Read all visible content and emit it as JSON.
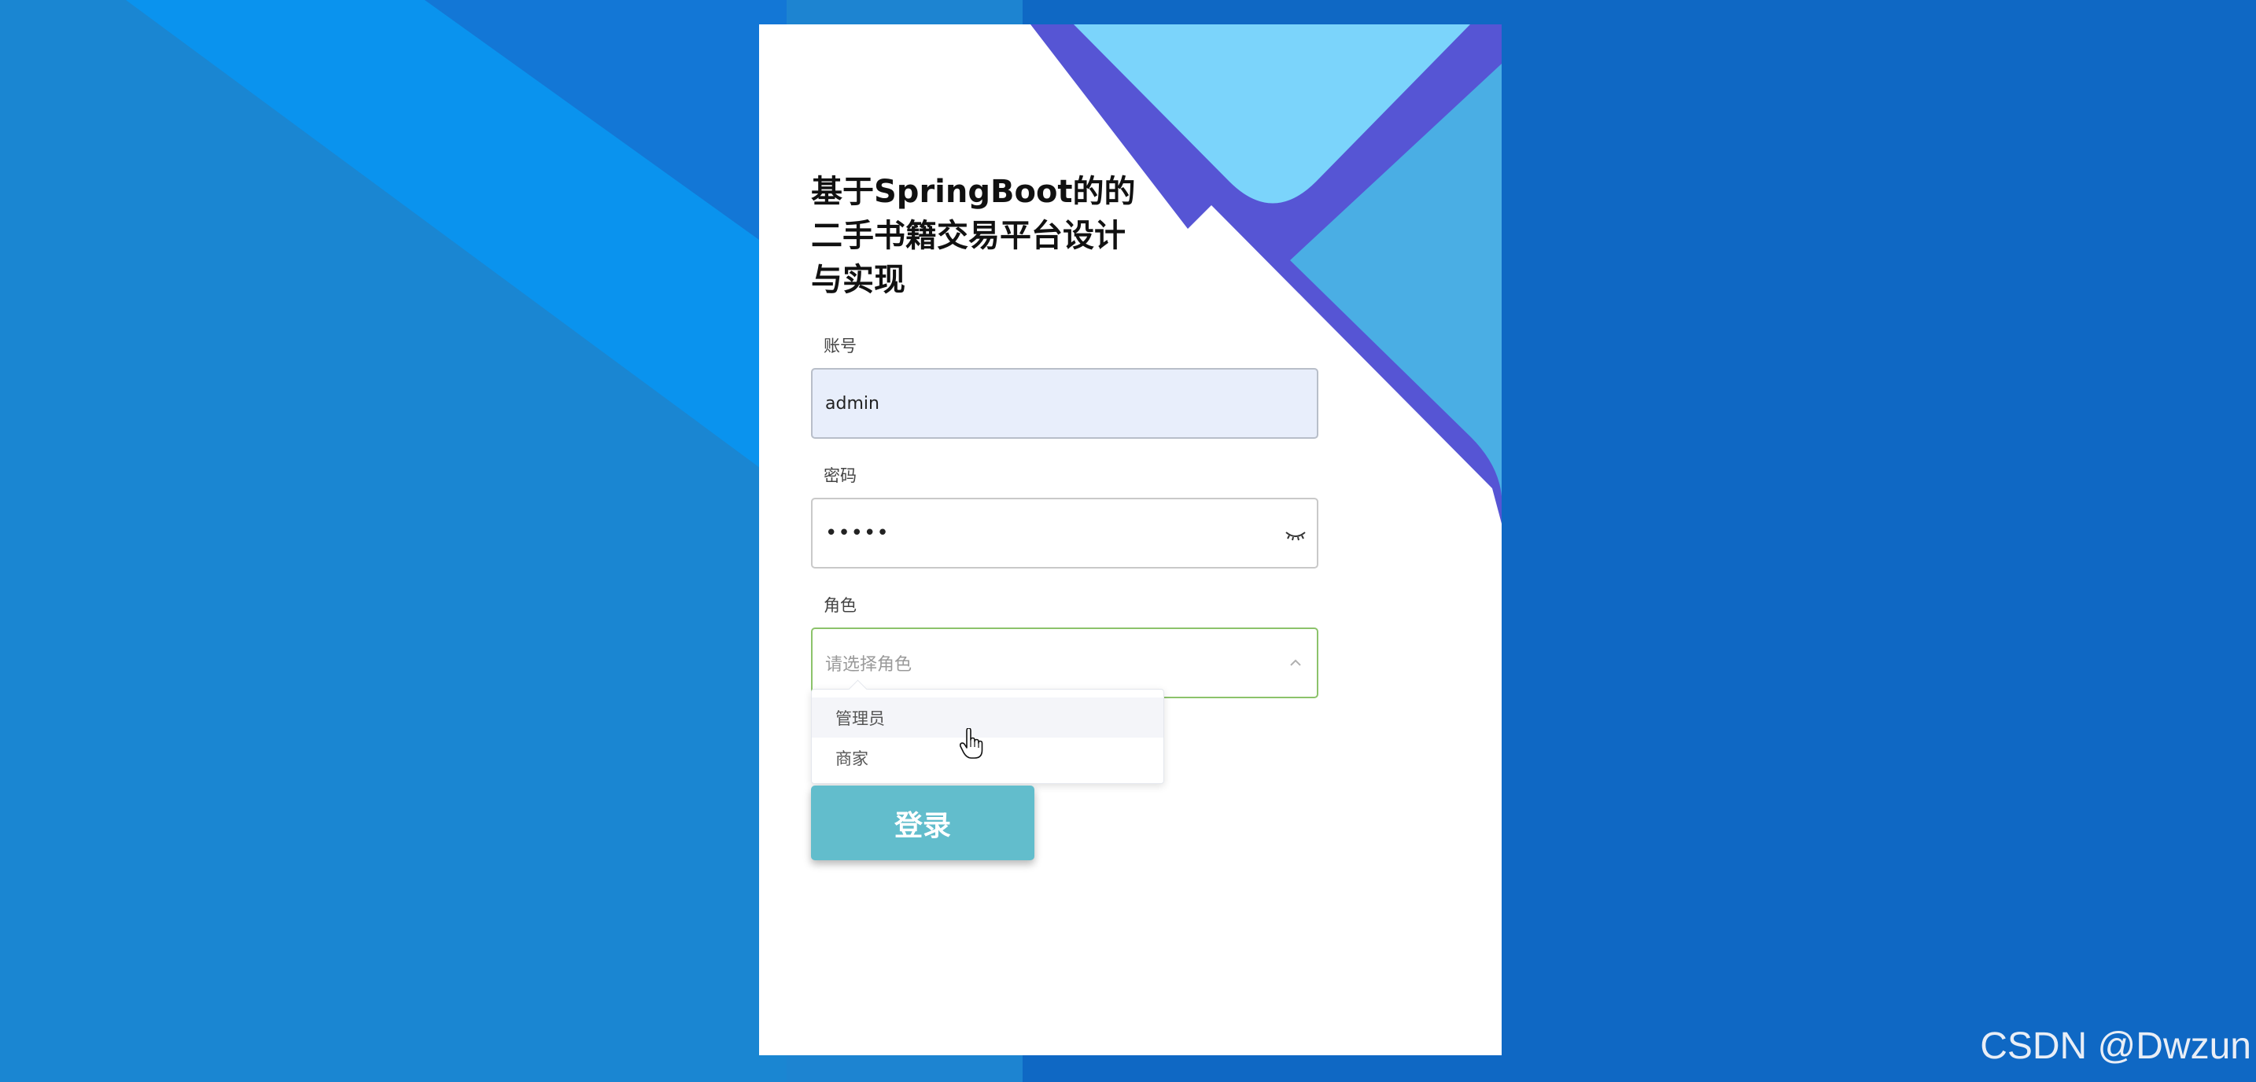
{
  "title": "基于SpringBoot的的\n二手书籍交易平台设计\n与实现",
  "form": {
    "account": {
      "label": "账号",
      "value": "admin"
    },
    "password": {
      "label": "密码",
      "value": "•••••"
    },
    "role": {
      "label": "角色",
      "placeholder": "请选择角色",
      "options": [
        "管理员",
        "商家"
      ],
      "hovered_option": "管理员"
    }
  },
  "login_button": "登录",
  "watermark": "CSDN @Dwzun",
  "colors": {
    "background": "#1b6fc8",
    "card": "#ffffff",
    "button": "#62bdcc",
    "focus_border": "#8cc36b"
  },
  "icons": {
    "password_toggle": "eye-closed-icon",
    "select_arrow": "chevron-up-icon",
    "cursor": "hand-pointer-icon"
  }
}
